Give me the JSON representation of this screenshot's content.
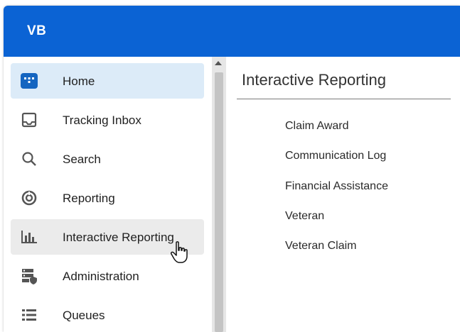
{
  "app": {
    "title": "VB"
  },
  "sidebar": {
    "items": [
      {
        "label": "Home",
        "icon": "home-icon",
        "active": true
      },
      {
        "label": "Tracking Inbox",
        "icon": "inbox-icon"
      },
      {
        "label": "Search",
        "icon": "search-icon"
      },
      {
        "label": "Reporting",
        "icon": "reporting-icon"
      },
      {
        "label": "Interactive Reporting",
        "icon": "bar-chart-icon",
        "hovered": true
      },
      {
        "label": "Administration",
        "icon": "administration-icon"
      },
      {
        "label": "Queues",
        "icon": "queues-icon"
      }
    ]
  },
  "main": {
    "title": "Interactive Reporting",
    "reports": [
      "Claim Award",
      "Communication Log",
      "Financial Assistance",
      "Veteran",
      "Veteran Claim"
    ]
  },
  "colors": {
    "header": "#0b63d4",
    "active_item_bg": "#dcebf8",
    "hover_item_bg": "#ebebeb",
    "home_icon": "#1565c0"
  }
}
